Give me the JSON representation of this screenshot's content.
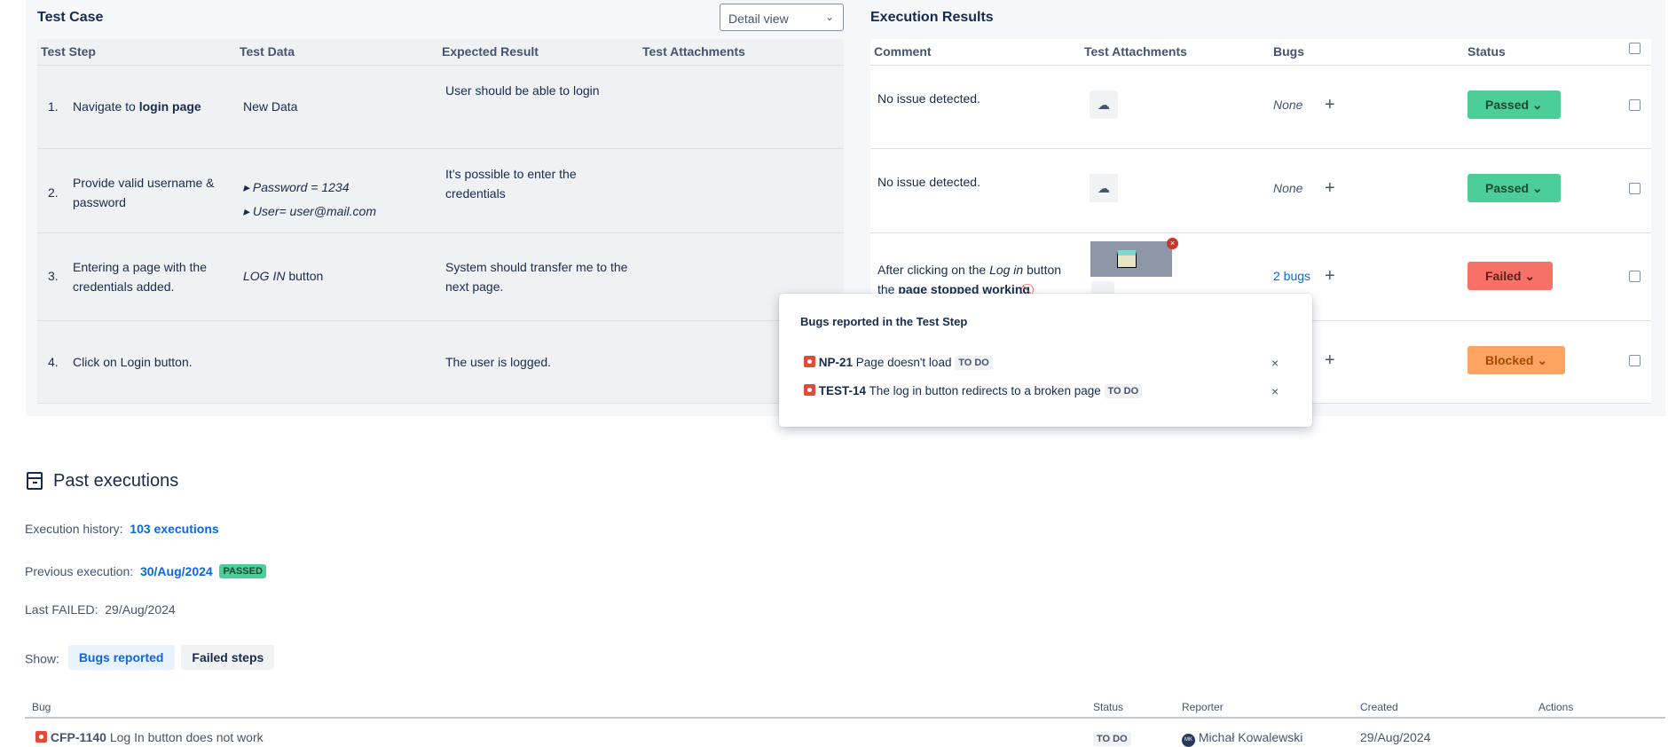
{
  "test_case": {
    "title": "Test Case",
    "view_select": "Detail view",
    "columns": [
      "Test Step",
      "Test Data",
      "Expected Result",
      "Test Attachments"
    ],
    "rows": [
      {
        "num": "1.",
        "step_plain": "Navigate to ",
        "step_bold": "login page",
        "data": "New Data",
        "expected": "User should be able to login"
      },
      {
        "num": "2.",
        "step_plain": "Provide valid username & password",
        "data_bullets": [
          "Password = 1234",
          "User= user@mail.com"
        ],
        "expected": "It’s possible to enter the credentials"
      },
      {
        "num": "3.",
        "step_plain": "Entering a page with the credentials added.",
        "data_italic": "LOG IN",
        "data_rest": " button",
        "expected": "System should transfer me to the next page."
      },
      {
        "num": "4.",
        "step_plain": "Click on Login button.",
        "expected": "The user is logged."
      }
    ]
  },
  "execution": {
    "title": "Execution Results",
    "columns": [
      "Comment",
      "Test Attachments",
      "Bugs",
      "Status"
    ],
    "rows": [
      {
        "comment": "No issue detected.",
        "bugs": "None",
        "status": "Passed"
      },
      {
        "comment": "No issue detected.",
        "bugs": "None",
        "status": "Passed"
      },
      {
        "comment_a": "After clicking on the ",
        "comment_i": "Log in",
        "comment_b": " button",
        "comment_c": "the ",
        "comment_bold": "page stopped working",
        "bugs": "2 bugs",
        "status": "Failed"
      },
      {
        "status": "Blocked"
      }
    ],
    "colors": {
      "passed": "#4bce97",
      "failed": "#f87168",
      "blocked": "#fea362"
    }
  },
  "popup": {
    "title": "Bugs reported in the Test Step",
    "bugs": [
      {
        "key": "NP-21",
        "summary": "Page doesn't load",
        "status": "TO DO"
      },
      {
        "key": "TEST-14",
        "summary": "The log in button redirects to a broken page",
        "status": "TO DO"
      }
    ],
    "remove": "×"
  },
  "past": {
    "title": "Past executions",
    "history_label": "Execution history:",
    "history_value": "103 executions",
    "prev_label": "Previous execution:",
    "prev_value": "30/Aug/2024",
    "prev_status": "PASSED",
    "last_failed_label": "Last FAILED:",
    "last_failed_value": "29/Aug/2024",
    "show_label": "Show:",
    "show_options": [
      "Bugs reported",
      "Failed steps"
    ],
    "columns": [
      "Bug",
      "Status",
      "Reporter",
      "Created",
      "Actions"
    ],
    "rows": [
      {
        "key": "CFP-1140",
        "summary": "Log In button does not work",
        "status": "TO DO",
        "reporter_initials": "MK",
        "reporter": "Michał Kowalewski",
        "created": "29/Aug/2024"
      }
    ]
  }
}
